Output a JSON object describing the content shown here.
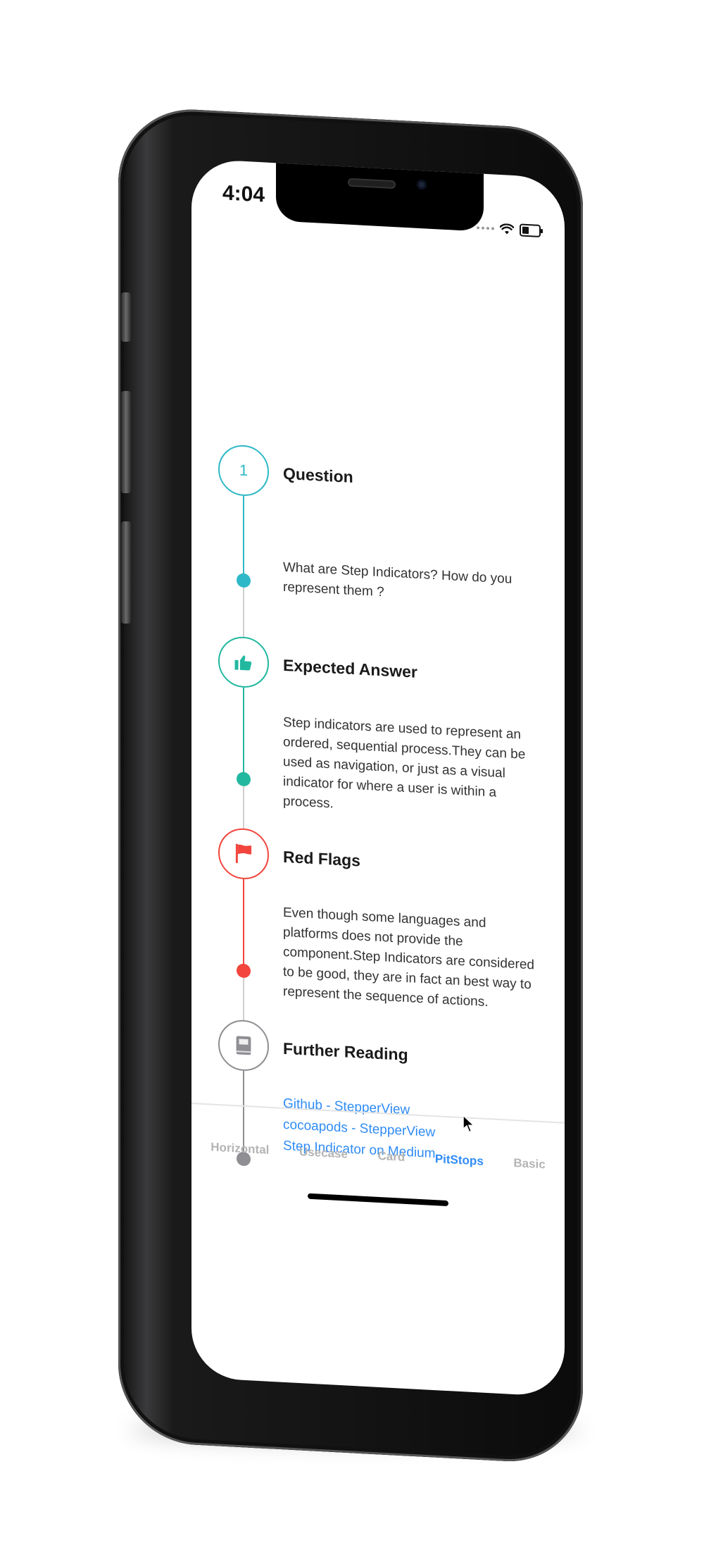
{
  "status_bar": {
    "time": "4:04"
  },
  "steps": [
    {
      "badge_number": "1",
      "title": "Question",
      "description": "What are Step Indicators? How do you represent them ?",
      "color": "#2fb8c7"
    },
    {
      "icon": "thumbs-up-icon",
      "title": "Expected Answer",
      "description": "Step indicators are used to represent an ordered, sequential process.They can be used as navigation, or just as a visual indicator for where a user is within a process.",
      "color": "#22b8a0"
    },
    {
      "icon": "flag-icon",
      "title": "Red Flags",
      "description": "Even though some languages and platforms does not provide the component.Step Indicators are considered to be good, they are in fact an best way to represent the sequence of actions.",
      "color": "#f2453d"
    },
    {
      "icon": "book-icon",
      "title": "Further Reading",
      "links": [
        "Github - StepperView",
        "cocoapods - StepperView",
        "Step Indicator on  Medium"
      ],
      "color": "#8e8e93"
    }
  ],
  "tabs": [
    {
      "label": "Horizontal",
      "active": false
    },
    {
      "label": "Usecase",
      "active": false
    },
    {
      "label": "Card",
      "active": false
    },
    {
      "label": "PitStops",
      "active": true
    },
    {
      "label": "Basic",
      "active": false
    }
  ],
  "colors": {
    "accent": "#2f8cf5",
    "inactive_tab": "#b4b4b4"
  }
}
